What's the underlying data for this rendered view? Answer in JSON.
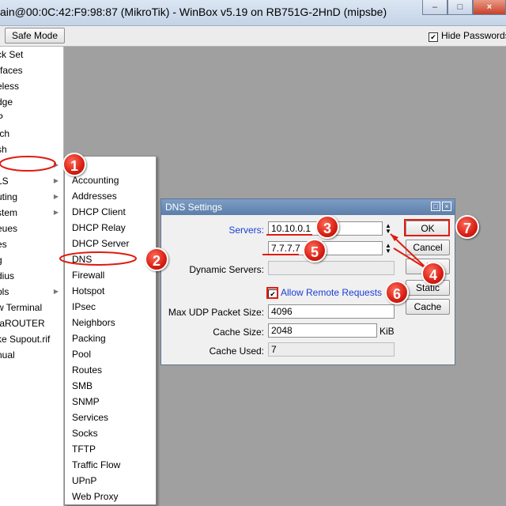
{
  "window": {
    "title": "ain@00:0C:42:F9:98:87 (MikroTik) - WinBox v5.19 on RB751G-2HnD (mipsbe)",
    "controls": {
      "minimize": "–",
      "maximize": "□",
      "close": "×"
    }
  },
  "toolbar": {
    "safe_mode_label": "Safe Mode",
    "hide_passwords_label": "Hide Passwords",
    "hide_passwords_checked": true
  },
  "sidebar": {
    "items": [
      {
        "label": "ck Set"
      },
      {
        "label": "rfaces"
      },
      {
        "label": "eless"
      },
      {
        "label": "dge"
      },
      {
        "label": "P"
      },
      {
        "label": "tch"
      },
      {
        "label": "sh"
      },
      {
        "label": ""
      },
      {
        "label": "LS"
      },
      {
        "label": "uting"
      },
      {
        "label": "stem"
      },
      {
        "label": "eues"
      },
      {
        "label": "es"
      },
      {
        "label": "g"
      },
      {
        "label": "dius"
      },
      {
        "label": "ols"
      },
      {
        "label": "w Terminal"
      },
      {
        "label": "taROUTER"
      },
      {
        "label": "ke Supout.rif"
      },
      {
        "label": "nual"
      },
      {
        "label": "t"
      }
    ]
  },
  "submenu": {
    "items": [
      {
        "label": "P"
      },
      {
        "label": "Accounting"
      },
      {
        "label": "Addresses"
      },
      {
        "label": "DHCP Client"
      },
      {
        "label": "DHCP Relay"
      },
      {
        "label": "DHCP Server"
      },
      {
        "label": "DNS"
      },
      {
        "label": "Firewall"
      },
      {
        "label": "Hotspot"
      },
      {
        "label": "IPsec"
      },
      {
        "label": "Neighbors"
      },
      {
        "label": "Packing"
      },
      {
        "label": "Pool"
      },
      {
        "label": "Routes"
      },
      {
        "label": "SMB"
      },
      {
        "label": "SNMP"
      },
      {
        "label": "Services"
      },
      {
        "label": "Socks"
      },
      {
        "label": "TFTP"
      },
      {
        "label": "Traffic Flow"
      },
      {
        "label": "UPnP"
      },
      {
        "label": "Web Proxy"
      }
    ]
  },
  "dns_dialog": {
    "title": "DNS Settings",
    "servers_label": "Servers:",
    "server1": "10.10.0.1",
    "server2": "7.7.7.7",
    "dynamic_servers_label": "Dynamic Servers:",
    "allow_remote_label": "Allow Remote Requests",
    "allow_remote_checked": true,
    "max_udp_label": "Max UDP Packet Size:",
    "max_udp_value": "4096",
    "cache_size_label": "Cache Size:",
    "cache_size_value": "2048",
    "cache_size_unit": "KiB",
    "cache_used_label": "Cache Used:",
    "cache_used_value": "7",
    "buttons": {
      "ok": "OK",
      "cancel": "Cancel",
      "apply": "A",
      "static": "Static",
      "cache": "Cache"
    }
  },
  "annotations": {
    "markers": [
      "1",
      "2",
      "3",
      "4",
      "5",
      "6",
      "7"
    ],
    "color": "#e01b10"
  },
  "colors": {
    "link_blue": "#1a3fd6",
    "dialog_title": "#6b8db8",
    "background": "#a0a0a0"
  }
}
